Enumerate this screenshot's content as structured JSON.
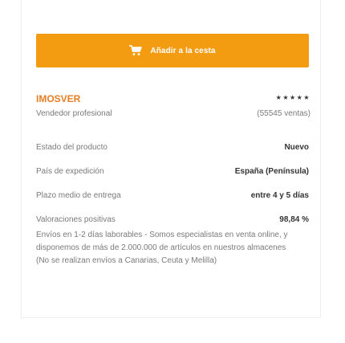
{
  "cart_button": {
    "label": "Añadir a la cesta",
    "icon": "cart-icon",
    "color": "#f39c12"
  },
  "seller": {
    "name": "IMOSVER",
    "type": "Vendedor profesional",
    "stars": "★★★★★",
    "rating": 5,
    "sales": "(55545 ventas)",
    "name_color": "#e67e22"
  },
  "details": [
    {
      "label": "Estado del producto",
      "value": "Nuevo"
    },
    {
      "label": "País de expedición",
      "value": "España (Península)"
    },
    {
      "label": "Plazo medio de entrega",
      "value": "entre 4 y 5 días"
    },
    {
      "label": "Valoraciones positivas",
      "value": "98,84 %"
    }
  ],
  "shipping_note": "Envíos en 1-2 días laborables - Somos especialistas en venta online, y disponemos de más de 2.000.000 de artículos en nuestros almacenes (No se realizan envíos a Canarias, Ceuta y Melilla)"
}
